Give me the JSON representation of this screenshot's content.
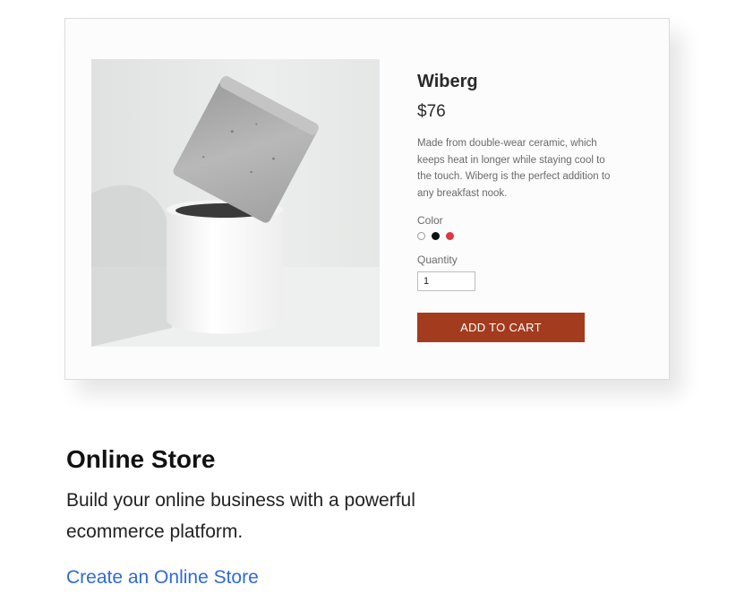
{
  "product": {
    "name": "Wiberg",
    "price": "$76",
    "description": "Made from double-wear ceramic, which keeps heat in longer while staying cool to the touch. Wiberg is the perfect addition to any breakfast nook.",
    "color_label": "Color",
    "colors": [
      {
        "name": "white",
        "hex": "#ffffff"
      },
      {
        "name": "black",
        "hex": "#111111"
      },
      {
        "name": "red",
        "hex": "#e0383c"
      }
    ],
    "quantity_label": "Quantity",
    "quantity_value": "1",
    "add_to_cart_label": "ADD TO CART",
    "button_color": "#a33b1f"
  },
  "feature": {
    "title": "Online Store",
    "description": "Build your online business with a powerful ecommerce platform.",
    "link_label": "Create an Online Store",
    "link_color": "#2f6ad9"
  }
}
